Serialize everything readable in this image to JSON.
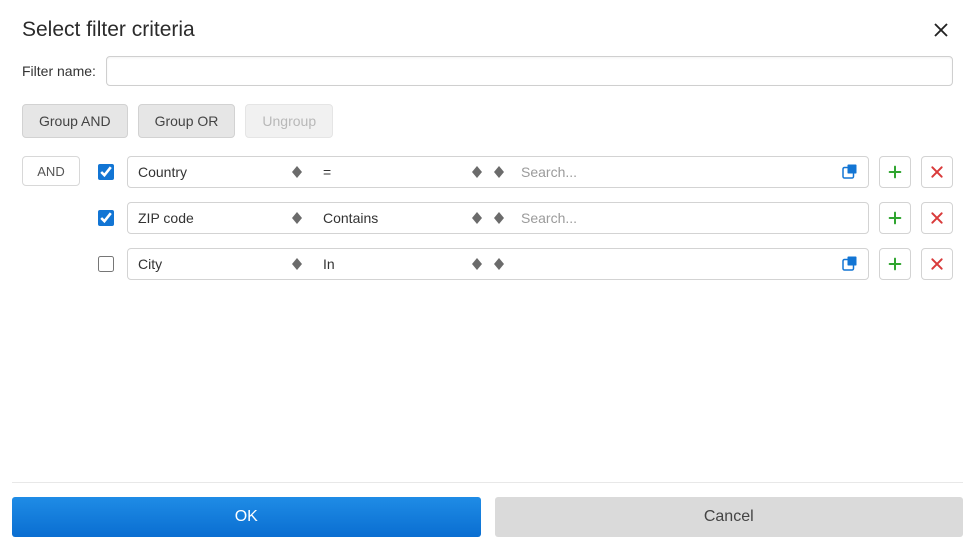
{
  "title": "Select filter criteria",
  "filter_name_label": "Filter name:",
  "filter_name_value": "",
  "group_buttons": {
    "and": "Group AND",
    "or": "Group OR",
    "ungroup": "Ungroup"
  },
  "combinator": "AND",
  "criteria": [
    {
      "checked": true,
      "field": "Country",
      "operator": "=",
      "search_placeholder": "Search...",
      "search_value": "",
      "has_open": true
    },
    {
      "checked": true,
      "field": "ZIP code",
      "operator": "Contains",
      "search_placeholder": "Search...",
      "search_value": "",
      "has_open": false
    },
    {
      "checked": false,
      "field": "City",
      "operator": "In",
      "search_placeholder": "",
      "search_value": "",
      "has_open": true
    }
  ],
  "footer": {
    "ok": "OK",
    "cancel": "Cancel"
  }
}
